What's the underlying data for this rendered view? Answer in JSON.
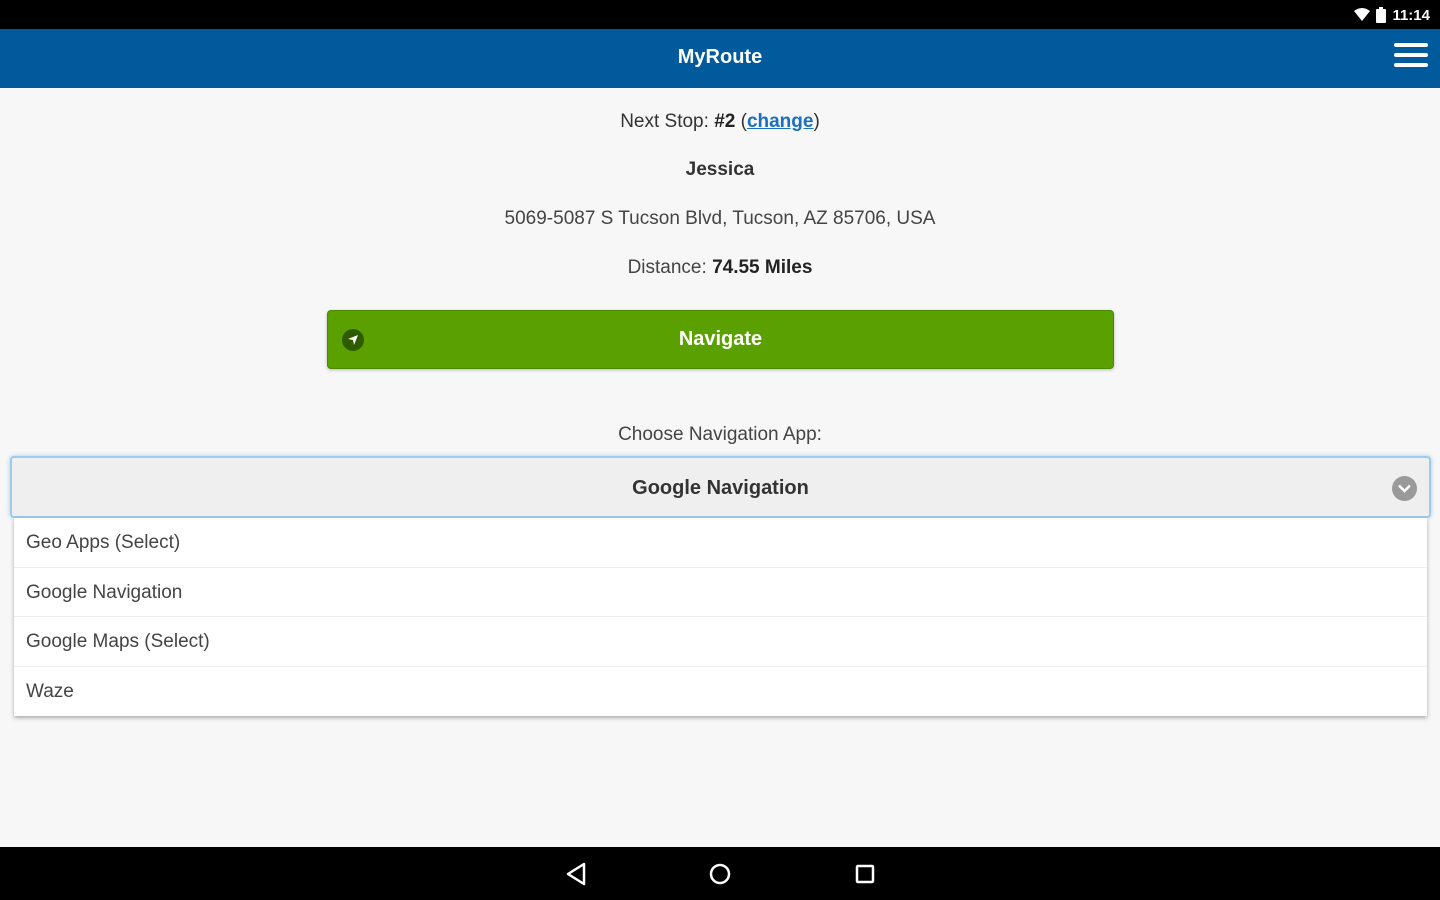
{
  "status_bar": {
    "time": "11:14",
    "icons": [
      "wifi-icon",
      "battery-icon"
    ]
  },
  "header": {
    "title": "MyRoute",
    "menu_icon": "hamburger-menu-icon"
  },
  "stop": {
    "next_stop_label": "Next Stop: ",
    "next_stop_number": "#2",
    "change_open": " (",
    "change_link": "change",
    "change_close": ")",
    "name": "Jessica",
    "address": "5069-5087 S Tucson Blvd, Tucson, AZ 85706, USA",
    "distance_label": "Distance: ",
    "distance_value": "74.55 Miles"
  },
  "navigate_button": {
    "label": "Navigate",
    "icon": "navigation-arrow-icon"
  },
  "nav_app": {
    "label": "Choose Navigation App:",
    "selected": "Google Navigation",
    "options": [
      {
        "label": "Geo Apps (Select)"
      },
      {
        "label": "Google Navigation"
      },
      {
        "label": "Google Maps (Select)"
      },
      {
        "label": "Waze"
      }
    ]
  },
  "colors": {
    "header_bg": "#005a9c",
    "navigate_bg": "#5aa100",
    "link": "#1a6fbf"
  },
  "system_nav": {
    "icons": [
      "back-icon",
      "home-icon",
      "recents-icon"
    ]
  }
}
